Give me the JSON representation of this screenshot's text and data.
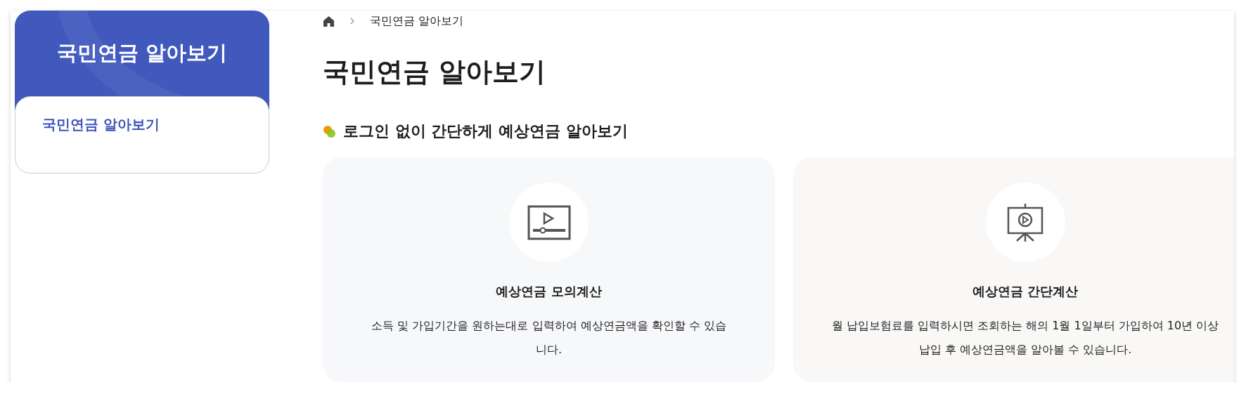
{
  "sidebar": {
    "title": "국민연금 알아보기",
    "items": [
      {
        "label": "국민연금 알아보기",
        "selected": true
      }
    ]
  },
  "breadcrumb": {
    "items": [
      "국민연금 알아보기"
    ]
  },
  "page_title": "국민연금 알아보기",
  "section": {
    "heading": "로그인 없이 간단하게 예상연금 알아보기"
  },
  "cards": [
    {
      "kind": "video",
      "title": "예상연금 모의계산",
      "description": "소득 및 가입기간을 원하는대로 입력하여 예상연금액을 확인할 수 있습니다."
    },
    {
      "kind": "presentation",
      "title": "예상연금 간단계산",
      "description": "월 납입보험료를 입력하시면 조회하는 해의 1월 1일부터 가입하여 10년 이상 납입 후 예상연금액을 알아볼 수 있습니다."
    }
  ]
}
